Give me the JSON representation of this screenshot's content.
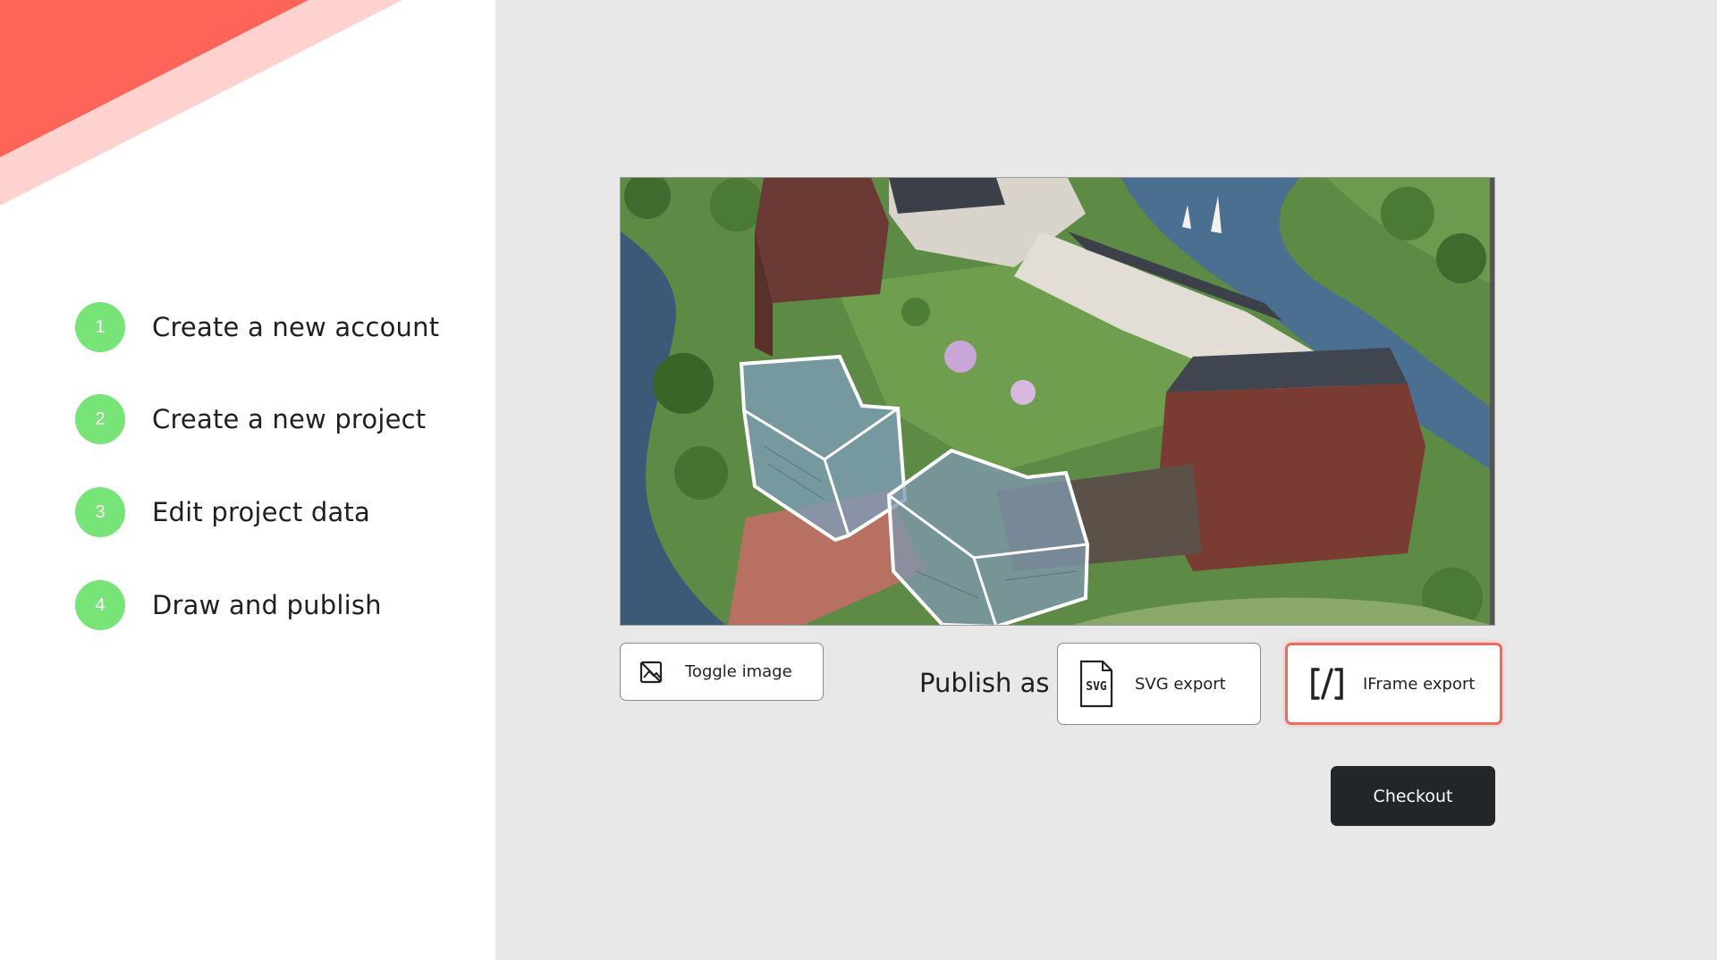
{
  "colors": {
    "accent_red": "#ff6459",
    "accent_pink": "#ffd2cf",
    "step_green": "#77e478",
    "checkout_bg": "#222628",
    "highlight_border": "#ef6a5c",
    "right_bg": "#e8e8e8"
  },
  "steps": [
    {
      "number": "1",
      "label": "Create a new account"
    },
    {
      "number": "2",
      "label": "Create a new project"
    },
    {
      "number": "3",
      "label": "Edit project data"
    },
    {
      "number": "4",
      "label": "Draw and publish"
    }
  ],
  "preview": {
    "image_description_icon": "image-icon"
  },
  "toolbar": {
    "toggle_image_label": "Toggle image",
    "toggle_image_icon": "image-toggle-icon",
    "publish_as_label": "Publish as",
    "svg_export_label": "SVG export",
    "svg_export_icon": "svg-file-icon",
    "svg_icon_text": "SVG",
    "iframe_export_label": "IFrame export",
    "iframe_export_icon": "code-icon",
    "checkout_label": "Checkout"
  }
}
